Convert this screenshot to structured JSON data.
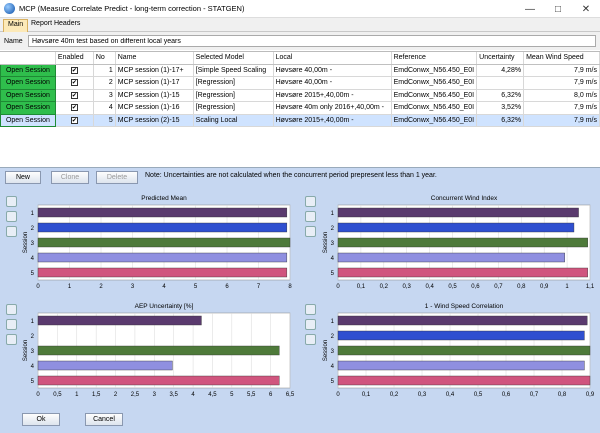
{
  "window": {
    "title": "MCP (Measure Correlate Predict - long-term correction - STATGEN)"
  },
  "tabs": [
    {
      "label": "Main"
    },
    {
      "label": "Report Headers"
    }
  ],
  "name_field": {
    "label": "Name",
    "value": "Høvsøre 40m test based on different local years"
  },
  "table": {
    "columns": [
      "",
      "Enabled",
      "No",
      "Name",
      "Selected Model",
      "Local",
      "Reference",
      "Uncertainty",
      "Mean Wind Speed"
    ],
    "rows": [
      {
        "button": "Open Session",
        "no": "1",
        "name": "MCP session (1)-17+",
        "model": "[Simple Speed Scaling",
        "local": "Høvsøre 40,00m -",
        "reference": "EmdConwx_N56.450_E0I",
        "uncertainty": "4,28%",
        "mean": "7,9 m/s"
      },
      {
        "button": "Open Session",
        "no": "2",
        "name": "MCP session (1)-17",
        "model": "[Regression]",
        "local": "Høvsøre 40,00m -",
        "reference": "EmdConwx_N56.450_E0I",
        "uncertainty": "",
        "mean": "7,9 m/s"
      },
      {
        "button": "Open Session",
        "no": "3",
        "name": "MCP session (1)-15",
        "model": "[Regression]",
        "local": "Høvsøre 2015+,40,00m -",
        "reference": "EmdConwx_N56.450_E0I",
        "uncertainty": "6,32%",
        "mean": "8,0 m/s"
      },
      {
        "button": "Open Session",
        "no": "4",
        "name": "MCP session (1)-16",
        "model": "[Regression]",
        "local": "Høvsøre 40m only 2016+,40,00m -",
        "reference": "EmdConwx_N56.450_E0I",
        "uncertainty": "3,52%",
        "mean": "7,9 m/s"
      },
      {
        "button": "Open Session",
        "no": "5",
        "name": "MCP session (2)-15",
        "model": "Scaling Local",
        "local": "Høvsøre 2015+,40,00m -",
        "reference": "EmdConwx_N56.450_E0I",
        "uncertainty": "6,32%",
        "mean": "7,9 m/s"
      }
    ]
  },
  "toolbar": {
    "new": "New",
    "clone": "Clone",
    "delete": "Delete",
    "note": "Note: Uncertainties are not calculated when the concurrent period prepresent less than 1 year."
  },
  "colors": {
    "s1": "#5a3a6e",
    "s2": "#2f4fd0",
    "s3": "#4e7a3a",
    "s4": "#8f8fe0",
    "s5": "#d0557e"
  },
  "chart_data": [
    {
      "type": "bar",
      "title": "Predicted Mean",
      "ylabel": "Session",
      "categories": [
        "1",
        "2",
        "3",
        "4",
        "5"
      ],
      "values": [
        7.9,
        7.9,
        8.0,
        7.9,
        7.9
      ],
      "xlim": [
        0,
        8
      ],
      "ticks": [
        "0",
        "1",
        "2",
        "3",
        "4",
        "5",
        "6",
        "7",
        "8"
      ]
    },
    {
      "type": "bar",
      "title": "Concurrent Wind Index",
      "ylabel": "Session",
      "categories": [
        "1",
        "2",
        "3",
        "4",
        "5"
      ],
      "values": [
        1.05,
        1.03,
        1.09,
        0.99,
        1.09
      ],
      "xlim": [
        0,
        1.1
      ],
      "ticks": [
        "0",
        "0,1",
        "0,2",
        "0,3",
        "0,4",
        "0,5",
        "0,6",
        "0,7",
        "0,8",
        "0,9",
        "1",
        "1,1"
      ]
    },
    {
      "type": "bar",
      "title": "AEP Uncertainty [%]",
      "ylabel": "Session",
      "categories": [
        "1",
        "2",
        "3",
        "4",
        "5"
      ],
      "values": [
        4.28,
        0,
        6.32,
        3.52,
        6.32
      ],
      "xlim": [
        0,
        6.6
      ],
      "ticks": [
        "0",
        "0,5",
        "1",
        "1,5",
        "2",
        "2,5",
        "3",
        "3,5",
        "4",
        "4,5",
        "5",
        "5,5",
        "6",
        "6,5"
      ]
    },
    {
      "type": "bar",
      "title": "1 - Wind Speed Correlation",
      "ylabel": "Session",
      "categories": [
        "1",
        "2",
        "3",
        "4",
        "5"
      ],
      "values": [
        0.89,
        0.88,
        0.9,
        0.88,
        0.9
      ],
      "xlim": [
        0,
        0.9
      ],
      "ticks": [
        "0",
        "0,1",
        "0,2",
        "0,3",
        "0,4",
        "0,5",
        "0,6",
        "0,7",
        "0,8",
        "0,9"
      ]
    }
  ],
  "footer": {
    "ok": "Ok",
    "cancel": "Cancel"
  }
}
